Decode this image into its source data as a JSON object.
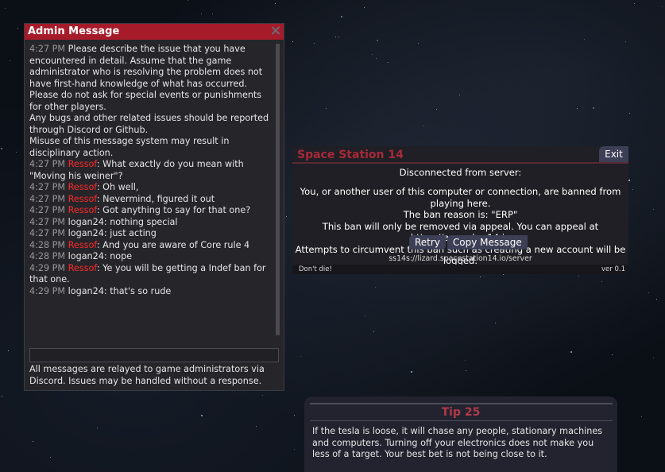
{
  "admin": {
    "title": "Admin Message",
    "close_glyph": "×",
    "log": [
      {
        "time": "4:27 PM",
        "user": "",
        "user_red": false,
        "text": "Please describe the issue that you have encountered in detail. Assume that the game administrator who is resolving the problem does not have first-hand knowledge of what has occurred."
      },
      {
        "time": "",
        "user": "",
        "user_red": false,
        "text": "Please do not ask for special events or punishments for other players."
      },
      {
        "time": "",
        "user": "",
        "user_red": false,
        "text": "Any bugs and other related issues should be reported through Discord or Github."
      },
      {
        "time": "",
        "user": "",
        "user_red": false,
        "text": "Misuse of this message system may result in disciplinary action."
      },
      {
        "time": "4:27 PM",
        "user": "Ressof",
        "user_red": true,
        "text": ": What exactly do you mean with \"Moving his weiner\"?"
      },
      {
        "time": "4:27 PM",
        "user": "Ressof",
        "user_red": true,
        "text": ": Oh well,"
      },
      {
        "time": "4:27 PM",
        "user": "Ressof",
        "user_red": true,
        "text": ": Nevermind, figured it out"
      },
      {
        "time": "4:27 PM",
        "user": "Ressof",
        "user_red": true,
        "text": ": Got anything to say for that one?"
      },
      {
        "time": "4:27 PM",
        "user": "logan24",
        "user_red": false,
        "text": ": nothing special"
      },
      {
        "time": "4:27 PM",
        "user": "logan24",
        "user_red": false,
        "text": ": just acting"
      },
      {
        "time": "4:28 PM",
        "user": "Ressof",
        "user_red": true,
        "text": ": And you are aware of Core rule 4"
      },
      {
        "time": "4:28 PM",
        "user": "logan24",
        "user_red": false,
        "text": ": nope"
      },
      {
        "time": "4:29 PM",
        "user": "Ressof",
        "user_red": true,
        "text": ": Ye you will be getting a Indef ban for that one."
      },
      {
        "time": "4:29 PM",
        "user": "logan24",
        "user_red": false,
        "text": ": that's so rude"
      }
    ],
    "input_value": "",
    "footer": "All messages are relayed to game administrators via Discord. Issues may be handled without a response."
  },
  "disconnect": {
    "title": "Space Station 14",
    "exit_label": "Exit",
    "heading": "Disconnected from server:",
    "lines": [
      "You, or another user of this computer or connection, are banned from playing here.",
      "The ban reason is: \"ERP\"",
      "This ban will only be removed via appeal. You can appeal at https://appeal.ss14.io",
      "Attempts to circumvent this ban such as creating a new account will be logged."
    ],
    "retry_label": "Retry",
    "copy_label": "Copy Message",
    "address": "ss14s://lizard.spacestation14.io/server",
    "motto": "Don't die!",
    "version": "ver 0.1"
  },
  "tip": {
    "title": "Tip 25",
    "text": "If the tesla is loose, it will chase any people, stationary machines and computers. Turning off your electronics does not make you less of a target. Your best bet is not being close to it."
  },
  "colors": {
    "admin_title_bg": "#a51b2a",
    "username_red": "#ff2a2a",
    "ss14_title": "#a82a3a",
    "button_bg": "#3c3f55"
  }
}
